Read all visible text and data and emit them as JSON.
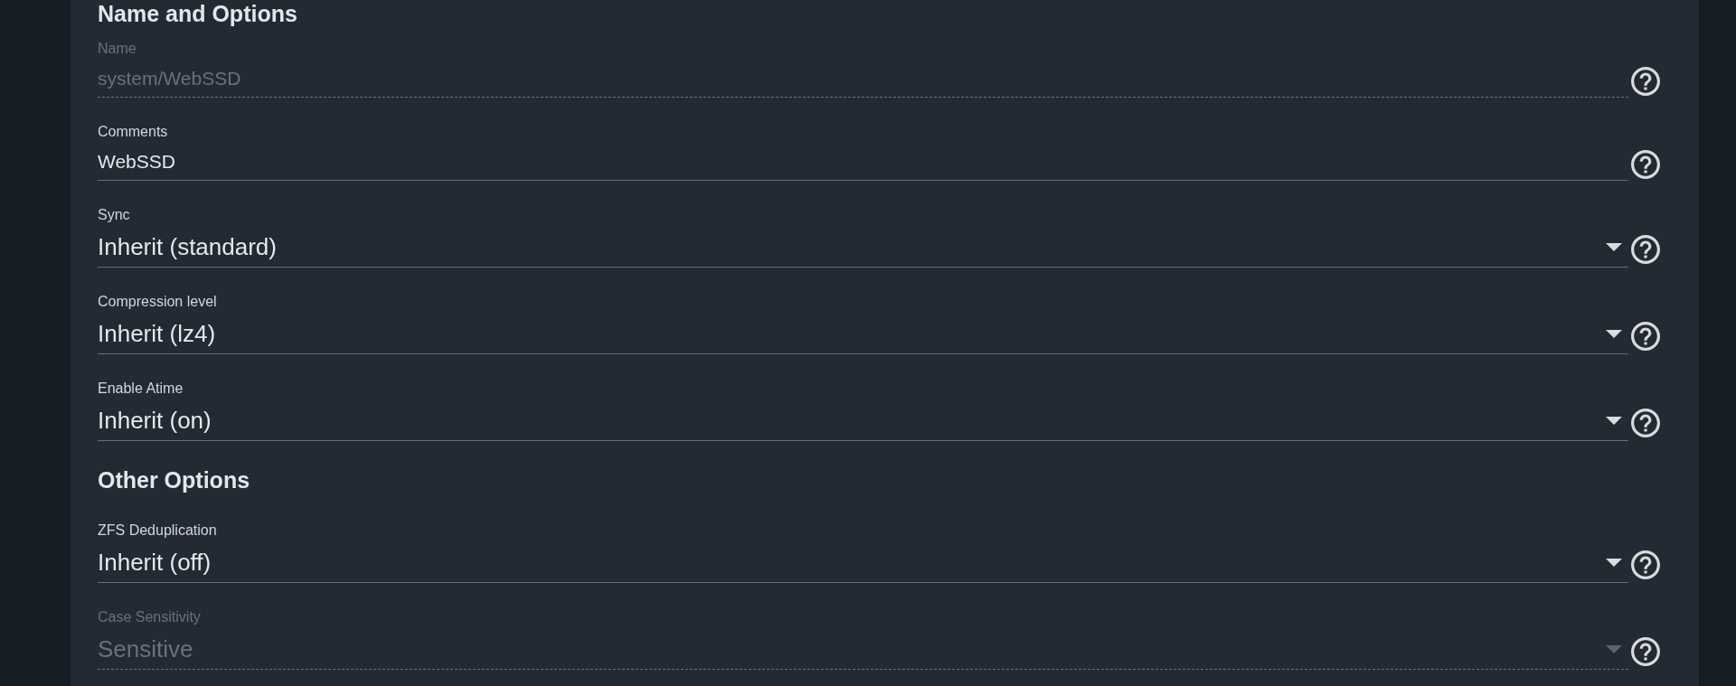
{
  "sections": [
    {
      "title": "Name and Options",
      "fields": [
        {
          "kind": "input",
          "label": "Name",
          "value": "system/WebSSD",
          "disabled": true
        },
        {
          "kind": "input",
          "label": "Comments",
          "value": "WebSSD",
          "disabled": false
        },
        {
          "kind": "select",
          "label": "Sync",
          "value": "Inherit (standard)",
          "disabled": false
        },
        {
          "kind": "select",
          "label": "Compression level",
          "value": "Inherit (lz4)",
          "disabled": false
        },
        {
          "kind": "select",
          "label": "Enable Atime",
          "value": "Inherit (on)",
          "disabled": false
        }
      ]
    },
    {
      "title": "Other Options",
      "fields": [
        {
          "kind": "select",
          "label": "ZFS Deduplication",
          "value": "Inherit (off)",
          "disabled": false
        },
        {
          "kind": "select",
          "label": "Case Sensitivity",
          "value": "Sensitive",
          "disabled": true
        }
      ]
    }
  ]
}
